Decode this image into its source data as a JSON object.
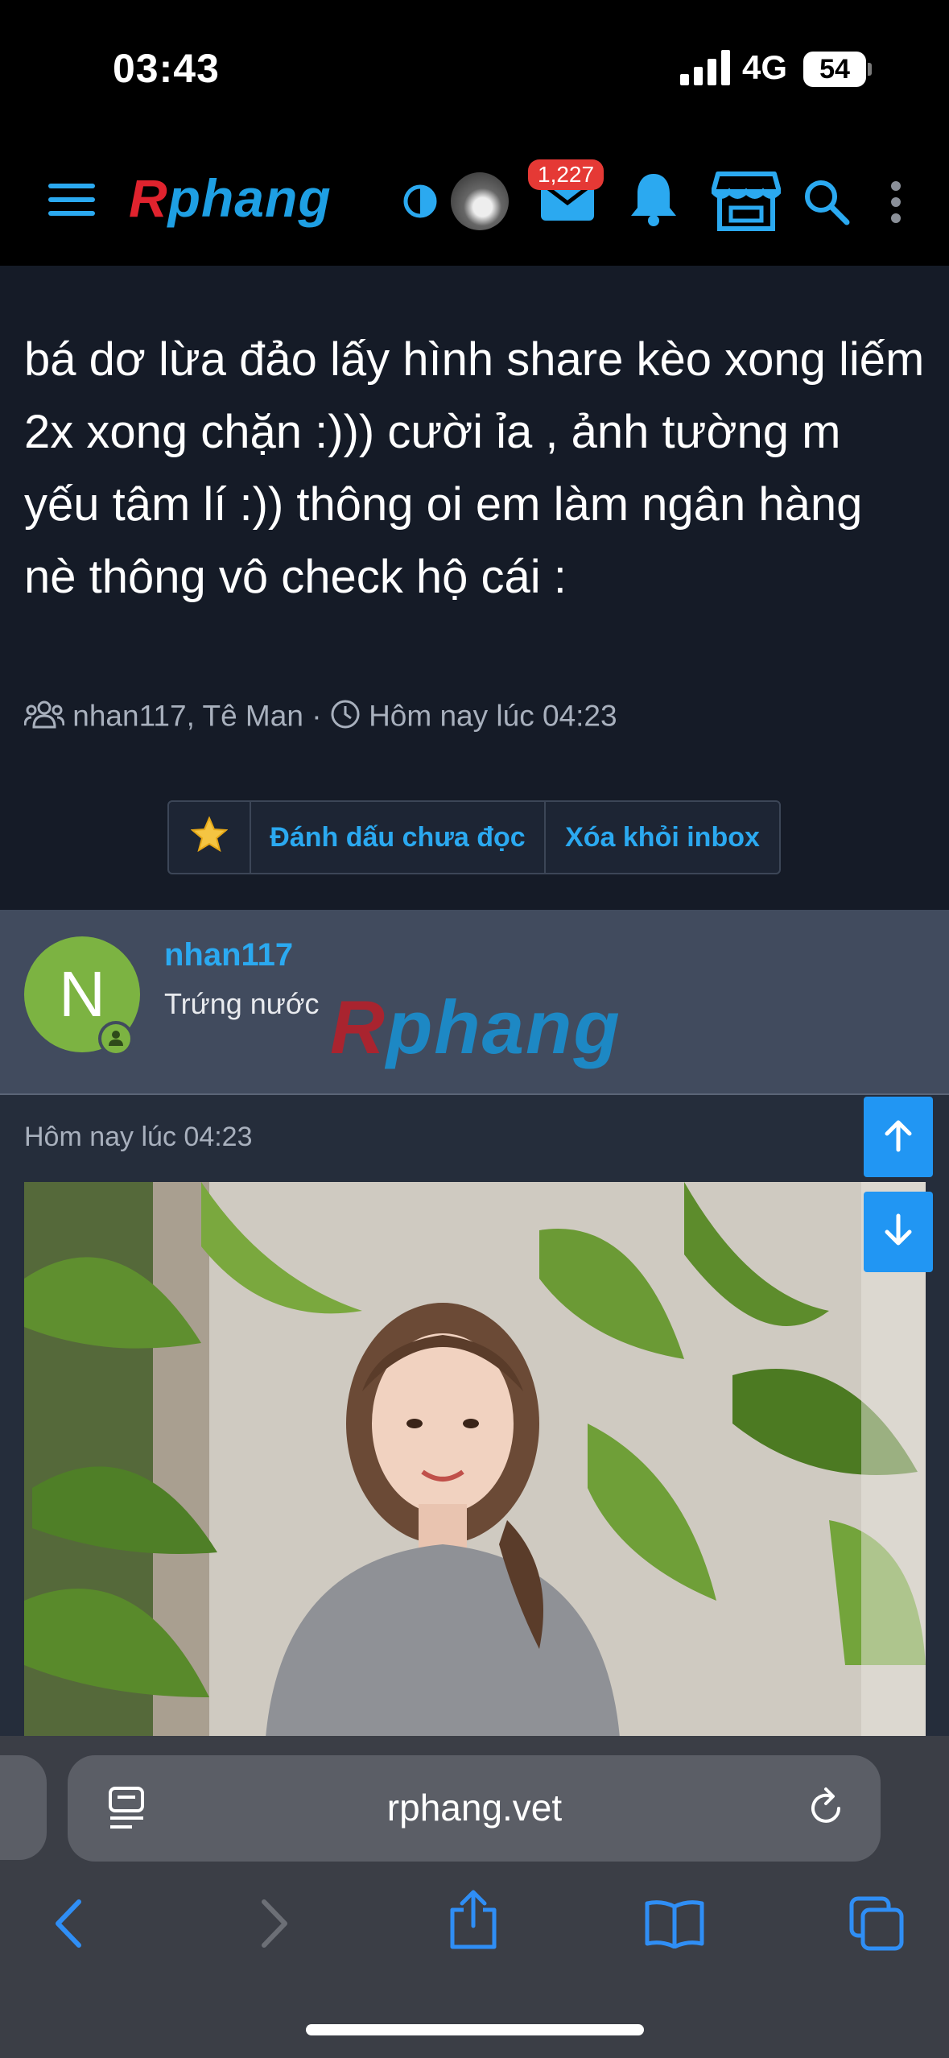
{
  "status_bar": {
    "time": "03:43",
    "network": "4G",
    "battery": "54"
  },
  "header": {
    "logo_r": "R",
    "logo_rest": "phang",
    "mail_badge": "1,227"
  },
  "thread": {
    "title": "bá dơ lừa đảo lấy hình share kèo xong liếm 2x xong chặn :))) cười ỉa , ảnh tường m yếu tâm lí :)) thông oi em làm ngân hàng nè thông vô check hộ cái :",
    "participants": "nhan117, Tê Man",
    "separator": "·",
    "date": "Hôm nay lúc 04:23",
    "buttons": {
      "mark_unread": "Đánh dấu chưa đọc",
      "remove_inbox": "Xóa khỏi inbox"
    }
  },
  "message": {
    "avatar_letter": "N",
    "username": "nhan117",
    "user_title": "Trứng nước",
    "watermark_r": "R",
    "watermark_rest": "phang",
    "date": "Hôm nay lúc 04:23"
  },
  "browser": {
    "url": "rphang.vet"
  },
  "colors": {
    "accent": "#2ba9f0",
    "badge": "#e53935",
    "avatar": "#7cb342"
  }
}
